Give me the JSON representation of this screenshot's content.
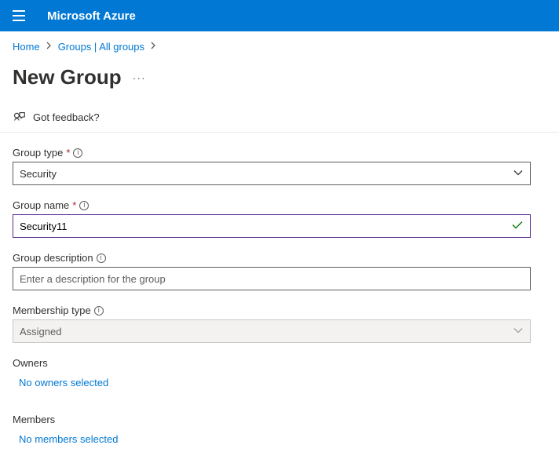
{
  "header": {
    "brand": "Microsoft Azure"
  },
  "breadcrumb": {
    "items": [
      "Home",
      "Groups | All groups"
    ]
  },
  "page": {
    "title": "New Group"
  },
  "feedback": {
    "label": "Got feedback?"
  },
  "form": {
    "group_type": {
      "label": "Group type",
      "required_marker": "*",
      "value": "Security"
    },
    "group_name": {
      "label": "Group name",
      "required_marker": "*",
      "value": "Security11"
    },
    "group_description": {
      "label": "Group description",
      "placeholder": "Enter a description for the group",
      "value": ""
    },
    "membership_type": {
      "label": "Membership type",
      "value": "Assigned"
    },
    "owners": {
      "label": "Owners",
      "link": "No owners selected"
    },
    "members": {
      "label": "Members",
      "link": "No members selected"
    }
  }
}
